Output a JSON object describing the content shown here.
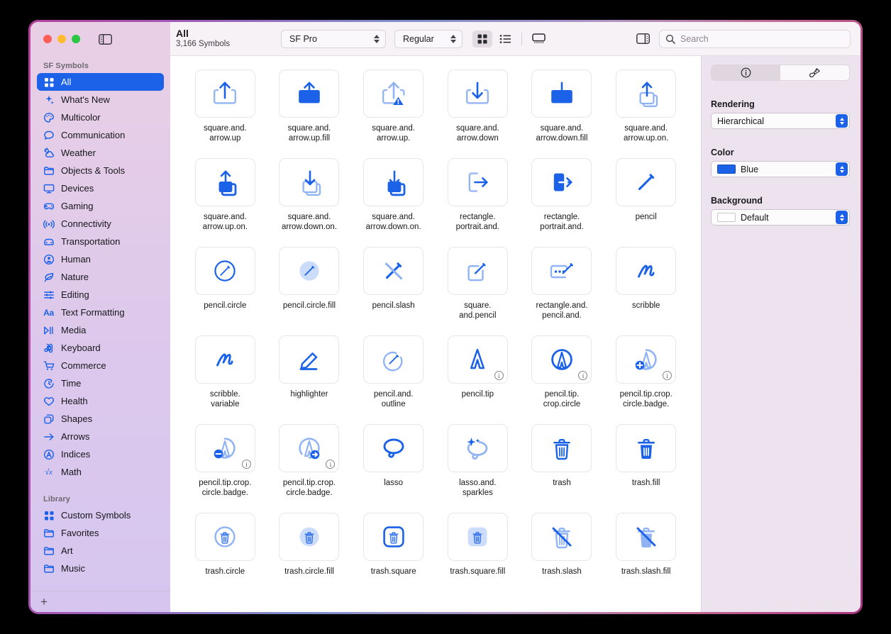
{
  "window": {
    "traffic_lights": [
      "close",
      "minimize",
      "zoom"
    ],
    "sidebar_toggle_icon": "sidebar-left-icon",
    "inspector_toggle_icon": "sidebar-right-icon"
  },
  "toolbar": {
    "title": "All",
    "subtitle": "3,166 Symbols",
    "font_popup": {
      "value": "SF Pro",
      "icon": "stepper-icon"
    },
    "weight_popup": {
      "value": "Regular",
      "icon": "stepper-icon"
    },
    "view_modes": [
      {
        "name": "grid-view",
        "icon": "grid-icon",
        "active": true
      },
      {
        "name": "list-view",
        "icon": "list-icon",
        "active": false
      },
      {
        "name": "gallery-view",
        "icon": "gallery-icon",
        "active": false
      }
    ],
    "search": {
      "placeholder": "Search",
      "value": "",
      "icon": "search-icon"
    }
  },
  "sidebar": {
    "section_symbols": "SF Symbols",
    "section_library": "Library",
    "add_button": "+",
    "items": [
      {
        "label": "All",
        "icon": "grid-icon",
        "selected": true
      },
      {
        "label": "What's New",
        "icon": "sparkles-icon",
        "selected": false
      },
      {
        "label": "Multicolor",
        "icon": "paintpalette-icon",
        "selected": false
      },
      {
        "label": "Communication",
        "icon": "bubble-icon",
        "selected": false
      },
      {
        "label": "Weather",
        "icon": "cloud-sun-icon",
        "selected": false
      },
      {
        "label": "Objects & Tools",
        "icon": "folder-icon",
        "selected": false
      },
      {
        "label": "Devices",
        "icon": "display-icon",
        "selected": false
      },
      {
        "label": "Gaming",
        "icon": "gamecontroller-icon",
        "selected": false
      },
      {
        "label": "Connectivity",
        "icon": "antenna-icon",
        "selected": false
      },
      {
        "label": "Transportation",
        "icon": "car-icon",
        "selected": false
      },
      {
        "label": "Human",
        "icon": "person-circle-icon",
        "selected": false
      },
      {
        "label": "Nature",
        "icon": "leaf-icon",
        "selected": false
      },
      {
        "label": "Editing",
        "icon": "sliders-icon",
        "selected": false
      },
      {
        "label": "Text Formatting",
        "icon": "textformat-icon",
        "selected": false
      },
      {
        "label": "Media",
        "icon": "playpause-icon",
        "selected": false
      },
      {
        "label": "Keyboard",
        "icon": "command-icon",
        "selected": false
      },
      {
        "label": "Commerce",
        "icon": "cart-icon",
        "selected": false
      },
      {
        "label": "Time",
        "icon": "timer-icon",
        "selected": false
      },
      {
        "label": "Health",
        "icon": "heart-icon",
        "selected": false
      },
      {
        "label": "Shapes",
        "icon": "shapes-icon",
        "selected": false
      },
      {
        "label": "Arrows",
        "icon": "arrow-right-icon",
        "selected": false
      },
      {
        "label": "Indices",
        "icon": "a-circle-icon",
        "selected": false
      },
      {
        "label": "Math",
        "icon": "square-root-icon",
        "selected": false
      }
    ],
    "library_items": [
      {
        "label": "Custom Symbols",
        "icon": "grid-icon"
      },
      {
        "label": "Favorites",
        "icon": "folder-icon"
      },
      {
        "label": "Art",
        "icon": "folder-icon"
      },
      {
        "label": "Music",
        "icon": "folder-icon"
      }
    ]
  },
  "inspector": {
    "tabs": [
      {
        "name": "info-tab",
        "icon": "info-circle-icon",
        "active": true
      },
      {
        "name": "style-tab",
        "icon": "paintbrush-icon",
        "active": false
      }
    ],
    "rendering": {
      "label": "Rendering",
      "value": "Hierarchical"
    },
    "color": {
      "label": "Color",
      "value": "Blue",
      "swatch": "#1b62e8"
    },
    "background": {
      "label": "Background",
      "value": "Default",
      "swatch": "#ffffff"
    }
  },
  "grid": {
    "accent": "#1b62e8",
    "accent_light": "#8fb3f4",
    "symbols": [
      {
        "name": "square.and.arrow.up",
        "caption": "square.and.\narrow.up",
        "icon": "square-and-arrow-up",
        "info": false
      },
      {
        "name": "square.and.arrow.up.fill",
        "caption": "square.and.\narrow.up.fill",
        "icon": "square-and-arrow-up-fill",
        "info": false
      },
      {
        "name": "square.and.arrow.up.trianglebadge.exclamationmark",
        "caption": "square.and.\narrow.up.",
        "icon": "square-and-arrow-up-badge",
        "info": false
      },
      {
        "name": "square.and.arrow.down",
        "caption": "square.and.\narrow.down",
        "icon": "square-and-arrow-down",
        "info": false
      },
      {
        "name": "square.and.arrow.down.fill",
        "caption": "square.and.\narrow.down.fill",
        "icon": "square-and-arrow-down-fill",
        "info": false
      },
      {
        "name": "square.and.arrow.up.on.square",
        "caption": "square.and.\narrow.up.on.",
        "icon": "square-and-arrow-up-on-square",
        "info": false
      },
      {
        "name": "square.and.arrow.up.on.square.fill",
        "caption": "square.and.\narrow.up.on.",
        "icon": "square-and-arrow-up-on-square-fill",
        "info": false
      },
      {
        "name": "square.and.arrow.down.on.square",
        "caption": "square.and.\narrow.down.on.",
        "icon": "square-and-arrow-down-on-square",
        "info": false
      },
      {
        "name": "square.and.arrow.down.on.square.fill",
        "caption": "square.and.\narrow.down.on.",
        "icon": "square-and-arrow-down-on-square-fill",
        "info": false
      },
      {
        "name": "rectangle.portrait.and.arrow.right",
        "caption": "rectangle.\nportrait.and.",
        "icon": "rectangle-portrait-arrow-right",
        "info": false
      },
      {
        "name": "rectangle.portrait.and.arrow.right.fill",
        "caption": "rectangle.\nportrait.and.",
        "icon": "rectangle-portrait-arrow-right-fill",
        "info": false
      },
      {
        "name": "pencil",
        "caption": "pencil",
        "icon": "pencil",
        "info": false
      },
      {
        "name": "pencil.circle",
        "caption": "pencil.circle",
        "icon": "pencil-circle",
        "info": false
      },
      {
        "name": "pencil.circle.fill",
        "caption": "pencil.circle.fill",
        "icon": "pencil-circle-fill",
        "info": false
      },
      {
        "name": "pencil.slash",
        "caption": "pencil.slash",
        "icon": "pencil-slash",
        "info": false
      },
      {
        "name": "square.and.pencil",
        "caption": "square.\nand.pencil",
        "icon": "square-and-pencil",
        "info": false
      },
      {
        "name": "rectangle.and.pencil.and.ellipsis",
        "caption": "rectangle.and.\npencil.and.",
        "icon": "rectangle-and-pencil-ellipsis",
        "info": false
      },
      {
        "name": "scribble",
        "caption": "scribble",
        "icon": "scribble",
        "info": false
      },
      {
        "name": "scribble.variable",
        "caption": "scribble.\nvariable",
        "icon": "scribble-variable",
        "info": false
      },
      {
        "name": "highlighter",
        "caption": "highlighter",
        "icon": "highlighter",
        "info": false
      },
      {
        "name": "pencil.and.outline",
        "caption": "pencil.and.\noutline",
        "icon": "pencil-and-outline",
        "info": false
      },
      {
        "name": "pencil.tip",
        "caption": "pencil.tip",
        "icon": "pencil-tip",
        "info": true
      },
      {
        "name": "pencil.tip.crop.circle",
        "caption": "pencil.tip.\ncrop.circle",
        "icon": "pencil-tip-crop-circle",
        "info": true
      },
      {
        "name": "pencil.tip.crop.circle.badge.plus",
        "caption": "pencil.tip.crop.\ncircle.badge.",
        "icon": "pencil-tip-crop-circle-badge-plus",
        "info": true
      },
      {
        "name": "pencil.tip.crop.circle.badge.minus",
        "caption": "pencil.tip.crop.\ncircle.badge.",
        "icon": "pencil-tip-crop-circle-badge-minus",
        "info": true
      },
      {
        "name": "pencil.tip.crop.circle.badge.arrow.forward",
        "caption": "pencil.tip.crop.\ncircle.badge.",
        "icon": "pencil-tip-crop-circle-badge-arrow",
        "info": true
      },
      {
        "name": "lasso",
        "caption": "lasso",
        "icon": "lasso",
        "info": false
      },
      {
        "name": "lasso.and.sparkles",
        "caption": "lasso.and.\nsparkles",
        "icon": "lasso-and-sparkles",
        "info": false
      },
      {
        "name": "trash",
        "caption": "trash",
        "icon": "trash",
        "info": false
      },
      {
        "name": "trash.fill",
        "caption": "trash.fill",
        "icon": "trash-fill",
        "info": false
      },
      {
        "name": "trash.circle",
        "caption": "trash.circle",
        "icon": "trash-circle",
        "info": false
      },
      {
        "name": "trash.circle.fill",
        "caption": "trash.circle.fill",
        "icon": "trash-circle-fill",
        "info": false
      },
      {
        "name": "trash.square",
        "caption": "trash.square",
        "icon": "trash-square",
        "info": false
      },
      {
        "name": "trash.square.fill",
        "caption": "trash.square.fill",
        "icon": "trash-square-fill",
        "info": false
      },
      {
        "name": "trash.slash",
        "caption": "trash.slash",
        "icon": "trash-slash",
        "info": false
      },
      {
        "name": "trash.slash.fill",
        "caption": "trash.slash.fill",
        "icon": "trash-slash-fill",
        "info": false
      }
    ]
  }
}
